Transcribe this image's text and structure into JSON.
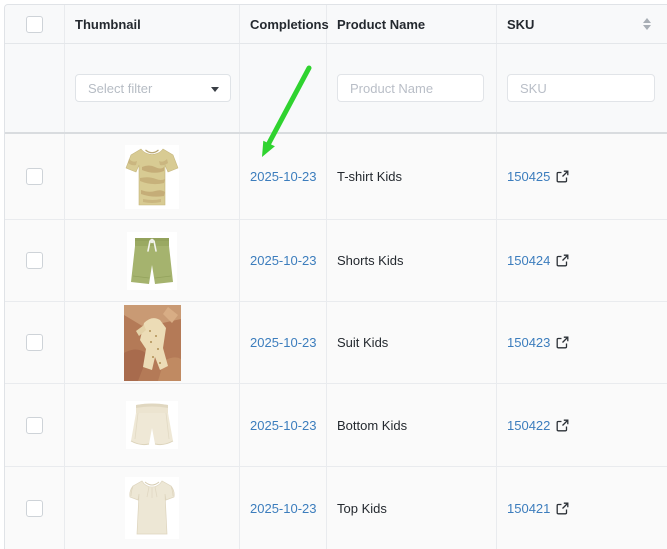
{
  "table": {
    "columns": [
      {
        "label": ""
      },
      {
        "label": "Thumbnail"
      },
      {
        "label": "Completions"
      },
      {
        "label": "Product Name"
      },
      {
        "label": "SKU"
      }
    ]
  },
  "filters": {
    "select_filter_placeholder": "Select filter",
    "product_name_placeholder": "Product Name",
    "sku_placeholder": "SKU"
  },
  "rows": [
    {
      "date": "2025-10-23",
      "product_name": "T-shirt Kids",
      "sku": "150425",
      "thumbnail": "camo-tshirt"
    },
    {
      "date": "2025-10-23",
      "product_name": "Shorts Kids",
      "sku": "150424",
      "thumbnail": "olive-shorts"
    },
    {
      "date": "2025-10-23",
      "product_name": "Suit Kids",
      "sku": "150423",
      "thumbnail": "suit-photo"
    },
    {
      "date": "2025-10-23",
      "product_name": "Bottom Kids",
      "sku": "150422",
      "thumbnail": "cream-shorts"
    },
    {
      "date": "2025-10-23",
      "product_name": "Top Kids",
      "sku": "150421",
      "thumbnail": "cream-top"
    }
  ],
  "annotation": {
    "type": "green-arrow",
    "color": "#2fd32f",
    "points_at": "first-row-completion-date"
  },
  "colors": {
    "link": "#3c7dbd",
    "header_bg": "#f8f9fa",
    "row_bg": "#fafafa"
  }
}
